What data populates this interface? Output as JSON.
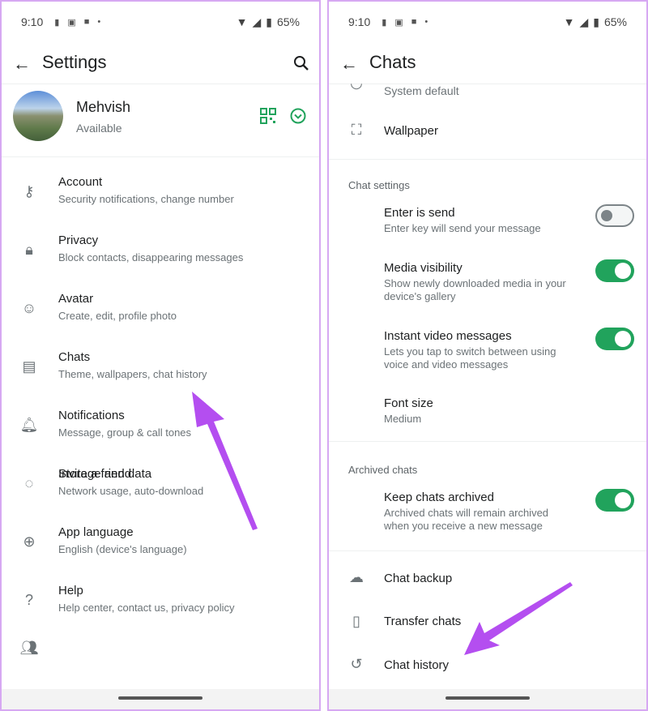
{
  "status_bar": {
    "time": "9:10",
    "battery": "65%"
  },
  "left": {
    "title": "Settings",
    "profile": {
      "name": "Mehvish",
      "status": "Available"
    },
    "items": [
      {
        "icon": "key-icon",
        "title": "Account",
        "subtitle": "Security notifications, change number"
      },
      {
        "icon": "lock-icon",
        "title": "Privacy",
        "subtitle": "Block contacts, disappearing messages"
      },
      {
        "icon": "avatar-icon",
        "title": "Avatar",
        "subtitle": "Create, edit, profile photo"
      },
      {
        "icon": "chat-icon",
        "title": "Chats",
        "subtitle": "Theme, wallpapers, chat history"
      },
      {
        "icon": "bell-icon",
        "title": "Notifications",
        "subtitle": "Message, group & call tones"
      },
      {
        "icon": "storage-icon",
        "title": "Storage and data",
        "subtitle": "Network usage, auto-download"
      },
      {
        "icon": "globe-icon",
        "title": "App language",
        "subtitle": "English (device's language)"
      },
      {
        "icon": "help-icon",
        "title": "Help",
        "subtitle": "Help center, contact us, privacy policy"
      },
      {
        "icon": "people-icon",
        "title": "Invite a friend",
        "subtitle": ""
      }
    ]
  },
  "right": {
    "title": "Chats",
    "theme_value": "System default",
    "wallpaper": "Wallpaper",
    "chat_settings_header": "Chat settings",
    "enter_is_send": {
      "title": "Enter is send",
      "subtitle": "Enter key will send your message",
      "enabled": false
    },
    "media_visibility": {
      "title": "Media visibility",
      "subtitle1": "Show newly downloaded media in your",
      "subtitle2": "device's gallery",
      "enabled": true
    },
    "instant_video": {
      "title": "Instant video messages",
      "subtitle1": "Lets you tap to switch between using",
      "subtitle2": "voice and video messages",
      "enabled": true
    },
    "font_size": {
      "title": "Font size",
      "value": "Medium"
    },
    "archived_header": "Archived chats",
    "keep_archived": {
      "title": "Keep chats archived",
      "subtitle1": "Archived chats will remain archived",
      "subtitle2": "when you receive a new message",
      "enabled": true
    },
    "chat_backup": "Chat backup",
    "transfer_chats": "Transfer chats",
    "chat_history": "Chat history"
  },
  "colors": {
    "accent": "#21a35c",
    "annotation_arrow": "#b44ef0",
    "panel_border": "#d6a8f2"
  }
}
